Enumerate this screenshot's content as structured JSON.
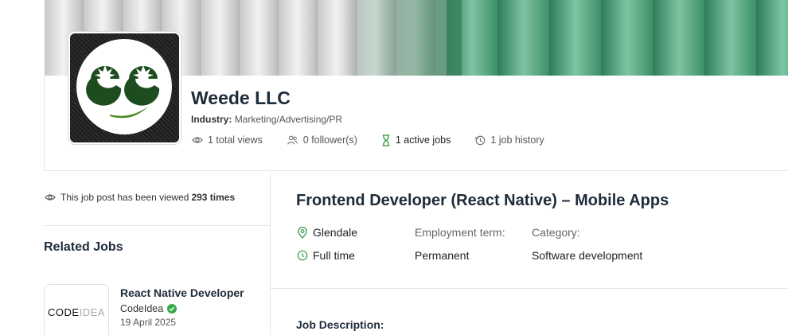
{
  "company": {
    "name": "Weede LLC",
    "industry_label": "Industry:",
    "industry_value": "Marketing/Advertising/PR",
    "stats": {
      "views": "1 total views",
      "followers": "0 follower(s)",
      "active_jobs": "1 active jobs",
      "job_history": "1 job history"
    },
    "logo_icon": "weede-smiley-logo-icon"
  },
  "sidebar": {
    "views_note_prefix": "This job post has been viewed",
    "views_note_count": "293 times",
    "related_title": "Related Jobs",
    "related_jobs": [
      {
        "logo_text_bold": "CODE",
        "logo_text_thin": "IDEA",
        "title": "React Native Developer",
        "company": "CodeIdea",
        "date": "19 April 2025"
      }
    ]
  },
  "job": {
    "title": "Frontend Developer (React Native) – Mobile Apps",
    "location": "Glendale",
    "schedule": "Full time",
    "employment_term_label": "Employment term:",
    "employment_term_value": "Permanent",
    "category_label": "Category:",
    "category_value": "Software development",
    "description_title": "Job Description:"
  },
  "colors": {
    "accent_green": "#3a9d4a",
    "title_dark": "#1e2b3a",
    "verified_green": "#37a84a"
  }
}
